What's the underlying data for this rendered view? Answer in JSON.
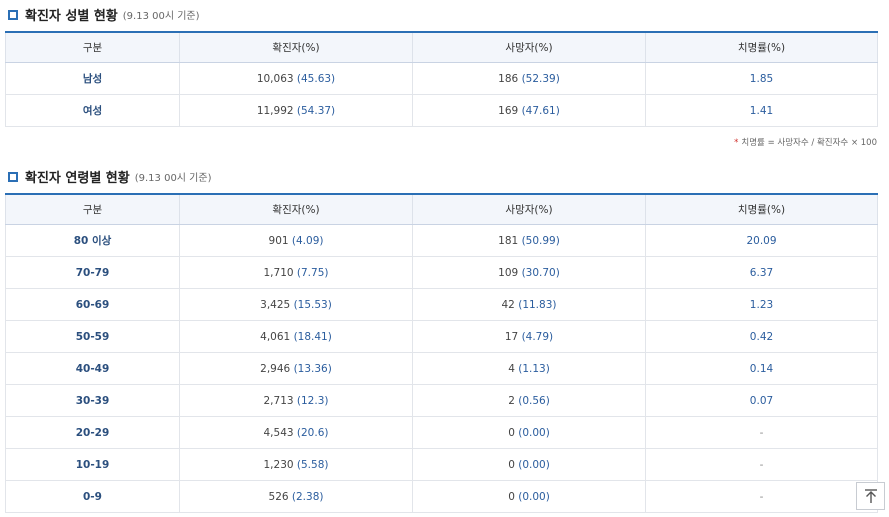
{
  "gender_section": {
    "title": "확진자 성별 현황",
    "subtitle": "(9.13 00시 기준)",
    "headers": [
      "구분",
      "확진자(%)",
      "사망자(%)",
      "치명률(%)"
    ],
    "rows": [
      {
        "label": "남성",
        "confirmed": "10,063",
        "confirmed_pct": "(45.63)",
        "deaths": "186",
        "deaths_pct": "(52.39)",
        "fatality": "1.85"
      },
      {
        "label": "여성",
        "confirmed": "11,992",
        "confirmed_pct": "(54.37)",
        "deaths": "169",
        "deaths_pct": "(47.61)",
        "fatality": "1.41"
      }
    ],
    "note_star": "*",
    "note": "치명률 = 사망자수 / 확진자수 × 100"
  },
  "age_section": {
    "title": "확진자 연령별 현황",
    "subtitle": "(9.13 00시 기준)",
    "headers": [
      "구분",
      "확진자(%)",
      "사망자(%)",
      "치명률(%)"
    ],
    "rows": [
      {
        "label": "80 이상",
        "confirmed": "901",
        "confirmed_pct": "(4.09)",
        "deaths": "181",
        "deaths_pct": "(50.99)",
        "fatality": "20.09"
      },
      {
        "label": "70-79",
        "confirmed": "1,710",
        "confirmed_pct": "(7.75)",
        "deaths": "109",
        "deaths_pct": "(30.70)",
        "fatality": "6.37"
      },
      {
        "label": "60-69",
        "confirmed": "3,425",
        "confirmed_pct": "(15.53)",
        "deaths": "42",
        "deaths_pct": "(11.83)",
        "fatality": "1.23"
      },
      {
        "label": "50-59",
        "confirmed": "4,061",
        "confirmed_pct": "(18.41)",
        "deaths": "17",
        "deaths_pct": "(4.79)",
        "fatality": "0.42"
      },
      {
        "label": "40-49",
        "confirmed": "2,946",
        "confirmed_pct": "(13.36)",
        "deaths": "4",
        "deaths_pct": "(1.13)",
        "fatality": "0.14"
      },
      {
        "label": "30-39",
        "confirmed": "2,713",
        "confirmed_pct": "(12.3)",
        "deaths": "2",
        "deaths_pct": "(0.56)",
        "fatality": "0.07"
      },
      {
        "label": "20-29",
        "confirmed": "4,543",
        "confirmed_pct": "(20.6)",
        "deaths": "0",
        "deaths_pct": "(0.00)",
        "fatality": "-"
      },
      {
        "label": "10-19",
        "confirmed": "1,230",
        "confirmed_pct": "(5.58)",
        "deaths": "0",
        "deaths_pct": "(0.00)",
        "fatality": "-"
      },
      {
        "label": "0-9",
        "confirmed": "526",
        "confirmed_pct": "(2.38)",
        "deaths": "0",
        "deaths_pct": "(0.00)",
        "fatality": "-"
      }
    ]
  },
  "top_button": {
    "icon": "arrow-up-to-top-icon"
  },
  "colors": {
    "accent": "#2b6fb5",
    "header_bg": "#f3f6fb",
    "percent_text": "#2b5d9e",
    "note_star": "#d0312d"
  }
}
